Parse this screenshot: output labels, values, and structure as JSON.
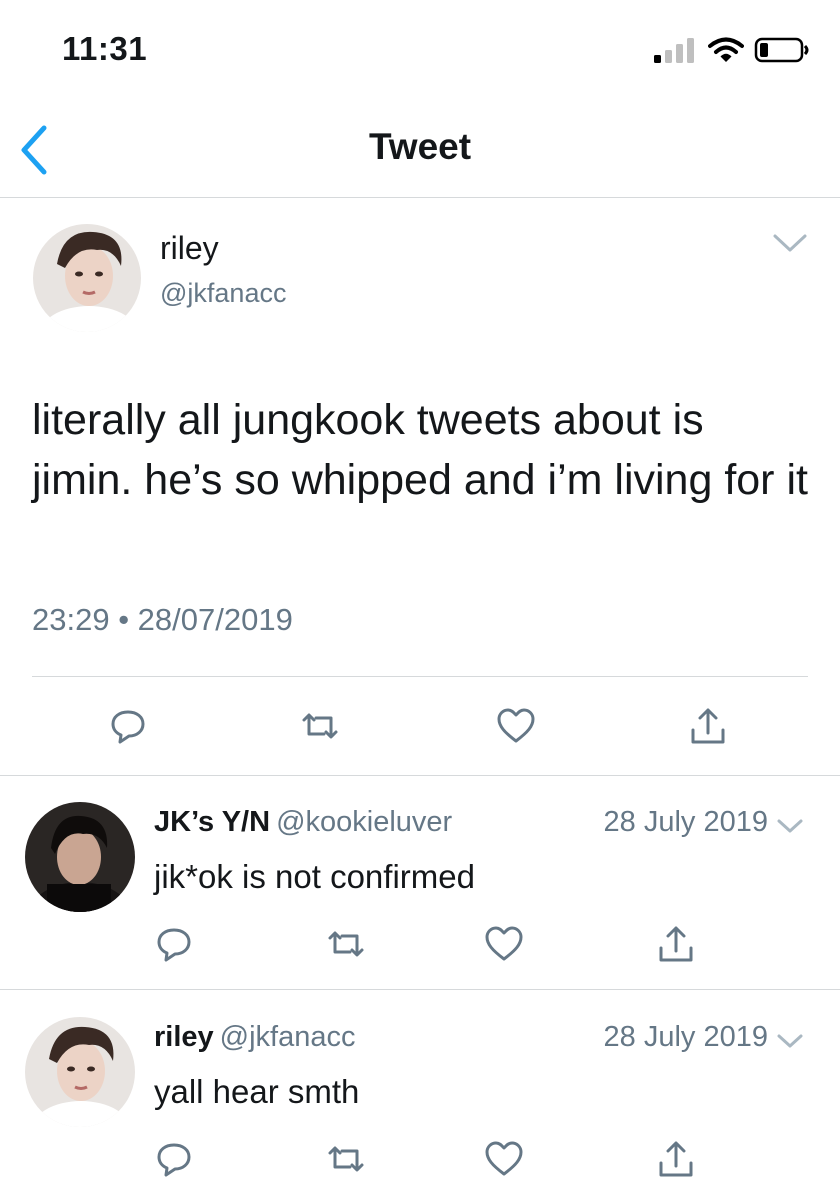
{
  "status_bar": {
    "time": "11:31"
  },
  "nav": {
    "title": "Tweet"
  },
  "main_tweet": {
    "author_name": "riley",
    "author_handle": "@jkfanacc",
    "text": "literally all jungkook tweets about is jimin. he’s so whipped and i’m living for it",
    "timestamp": "23:29 • 28/07/2019"
  },
  "replies": [
    {
      "name": "JK’s Y/N",
      "handle": "@kookieluver",
      "date": "28 July 2019",
      "text": "jik*ok is not confirmed"
    },
    {
      "name": "riley",
      "handle": "@jkfanacc",
      "date": "28 July 2019",
      "text": "yall hear smth"
    }
  ],
  "icons": {
    "back": "chevron-left-icon",
    "caret": "chevron-down-icon",
    "reply": "reply-icon",
    "retweet": "retweet-icon",
    "like": "heart-icon",
    "share": "share-icon"
  },
  "colors": {
    "accent": "#1da1f2",
    "secondary_text": "#657786",
    "icon_gray": "#657786",
    "divider": "#d6d9db"
  }
}
